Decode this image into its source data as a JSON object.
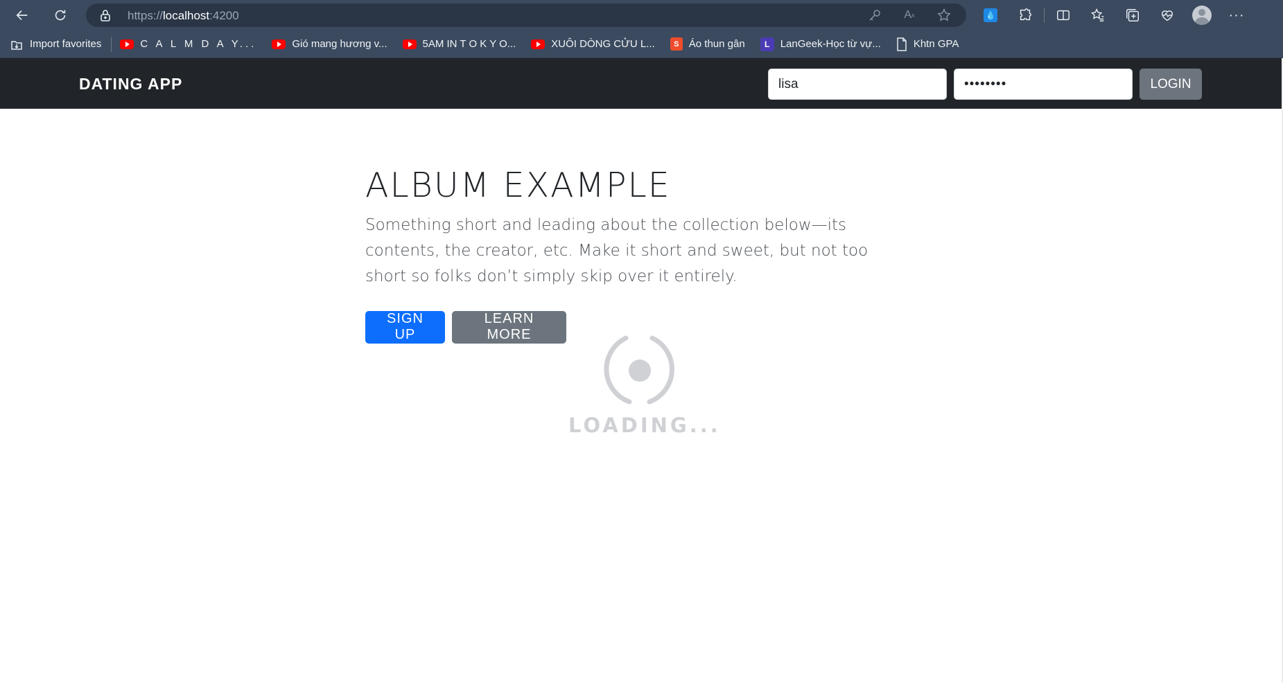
{
  "browser": {
    "url_scheme": "https://",
    "url_host": "localhost",
    "url_rest": ":4200",
    "bookmarks": [
      {
        "label": "Import favorites",
        "icon": "import-icon"
      },
      {
        "label": "C A L M    D A Y...",
        "icon": "youtube-icon"
      },
      {
        "label": "Gió mang hương v...",
        "icon": "youtube-icon"
      },
      {
        "label": "5AM IN  T O K Y O...",
        "icon": "youtube-icon"
      },
      {
        "label": "XUÔI DÒNG CỬU L...",
        "icon": "youtube-icon"
      },
      {
        "label": "Áo thun gân",
        "icon": "shopee-icon"
      },
      {
        "label": "LanGeek-Học từ vự...",
        "icon": "langeek-icon"
      },
      {
        "label": "Khtn GPA",
        "icon": "page-icon"
      }
    ]
  },
  "navbar": {
    "brand": "DATING APP",
    "username_value": "lisa",
    "password_value": "••••••••",
    "login_label": "LOGIN",
    "background": "#212529"
  },
  "hero": {
    "title": "ALBUM EXAMPLE",
    "lead": "Something short and leading about the collection below—its contents, the creator, etc. Make it short and sweet, but not too short so folks don’t simply skip over it entirely.",
    "signup_label": "SIGN UP",
    "learn_more_label": "LEARN MORE"
  },
  "loader": {
    "text": "LOADING..."
  },
  "colors": {
    "primary": "#0d6efd",
    "secondary": "#6c757d",
    "chrome": "#3b4a5e"
  }
}
